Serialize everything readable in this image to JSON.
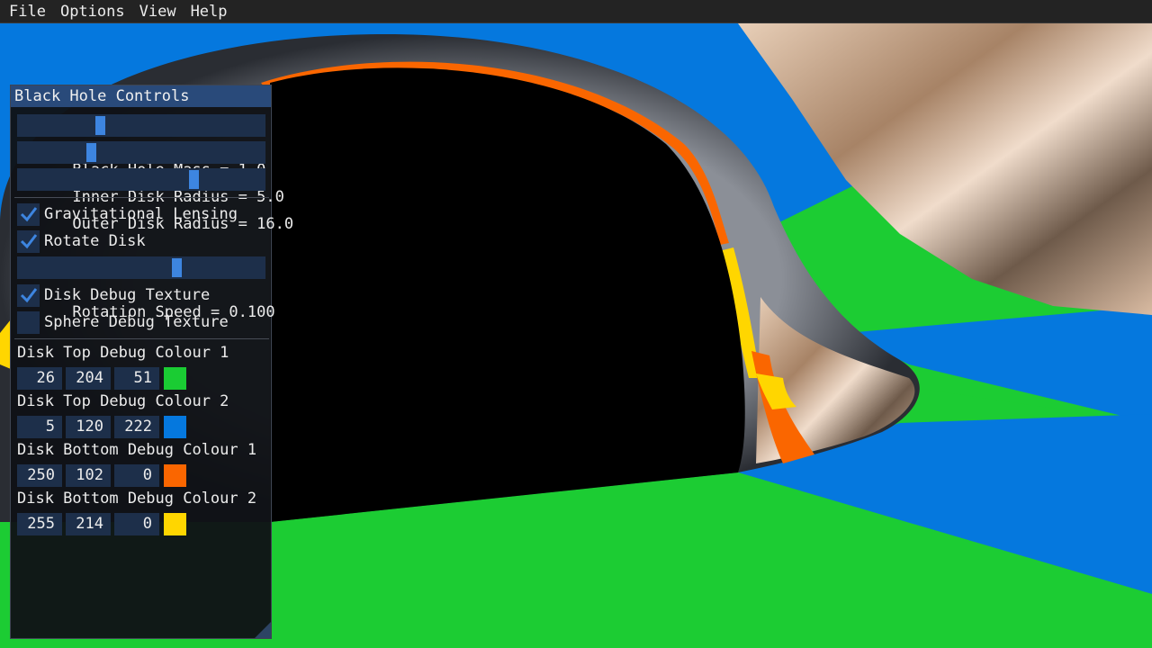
{
  "menu": {
    "items": [
      "File",
      "Options",
      "View",
      "Help"
    ]
  },
  "window": {
    "title": "Black Hole Controls",
    "sliders": {
      "mass": {
        "label": "Black Hole Mass = 1.0",
        "fraction": 0.33
      },
      "inner": {
        "label": "Inner Disk Radius = 5.0",
        "fraction": 0.29
      },
      "outer": {
        "label": "Outer Disk Radius = 16.0",
        "fraction": 0.72
      },
      "speed": {
        "label": "Rotation Speed = 0.100",
        "fraction": 0.65
      }
    },
    "checkboxes": {
      "lensing": {
        "label": "Gravitational Lensing",
        "checked": true
      },
      "rotate": {
        "label": "Rotate Disk",
        "checked": true
      },
      "disk_debug": {
        "label": "Disk Debug Texture",
        "checked": true
      },
      "sphere_debug": {
        "label": "Sphere Debug Texture",
        "checked": false
      }
    },
    "colours": [
      {
        "label": "Disk Top Debug Colour 1",
        "r": "26",
        "g": "204",
        "b": "51",
        "hex": "#1acc33"
      },
      {
        "label": "Disk Top Debug Colour 2",
        "r": "5",
        "g": "120",
        "b": "222",
        "hex": "#0578de"
      },
      {
        "label": "Disk Bottom Debug Colour 1",
        "r": "250",
        "g": "102",
        "b": "0",
        "hex": "#fa6600"
      },
      {
        "label": "Disk Bottom Debug Colour 2",
        "r": "255",
        "g": "214",
        "b": "0",
        "hex": "#ffd600"
      }
    ]
  },
  "scene": {
    "colors": {
      "green": "#1acc33",
      "blue": "#0578de",
      "orange": "#fa6600",
      "yellow": "#ffd600",
      "black": "#000000"
    }
  }
}
